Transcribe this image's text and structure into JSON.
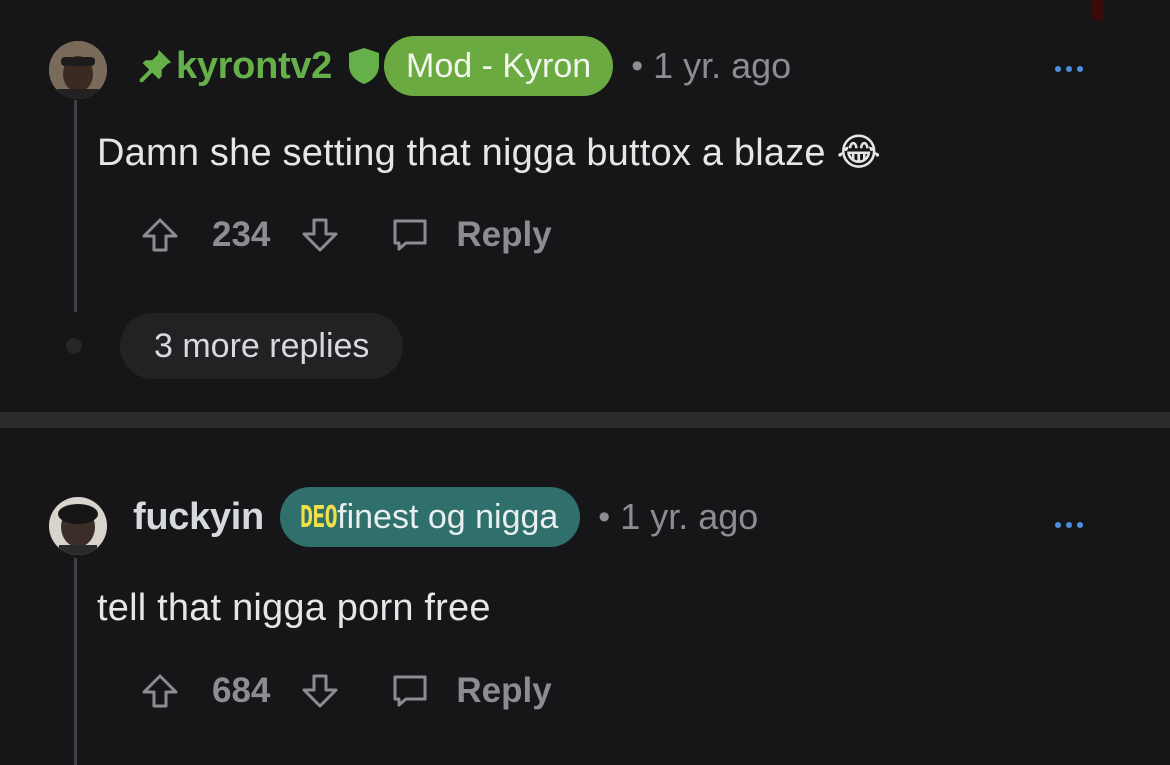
{
  "comments": [
    {
      "username": "kyrontv2",
      "flair": "Mod - Kyron",
      "separator": "•",
      "time": "1 yr. ago",
      "body": "Damn she setting that nigga buttox a blaze 😂",
      "score": "234",
      "reply_label": "Reply",
      "more_replies": "3 more replies",
      "icons": [
        "pin-icon",
        "mod-shield-icon",
        "upvote-icon",
        "downvote-icon",
        "comment-bubble-icon",
        "overflow-menu-icon"
      ]
    },
    {
      "username": "fuckyin",
      "flair_badge": "DEO",
      "flair": "finest og nigga",
      "separator": "•",
      "time": "1 yr. ago",
      "body": "tell that nigga porn free",
      "score": "684",
      "reply_label": "Reply",
      "icons": [
        "upvote-icon",
        "downvote-icon",
        "comment-bubble-icon",
        "overflow-menu-icon"
      ]
    }
  ],
  "colors": {
    "background": "#161618",
    "mod_green": "#66b04a",
    "mod_flair_bg": "#6aaa40",
    "teal_flair_bg": "#2f6f6c",
    "muted_text": "#8b8d90",
    "menu_blue": "#4a90e2"
  }
}
